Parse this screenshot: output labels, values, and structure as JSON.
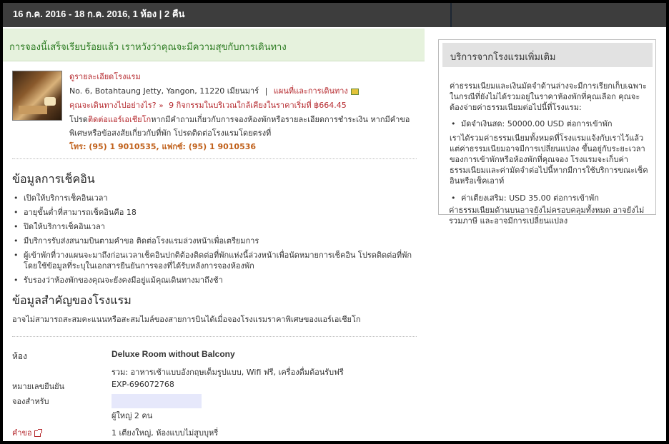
{
  "header": {
    "dates": "16 ก.ค. 2016 - 18 ก.ค. 2016, 1 ห้อง | 2 คืน"
  },
  "success": {
    "message": "การจองนี้เสร็จเรียบร้อยแล้ว เราหวังว่าคุณจะมีความสุขกับการเดินทาง"
  },
  "hotel": {
    "details_link": "ดูรายละเอียดโรงแรม",
    "address": "No. 6, Botahtaung Jetty, Yangon, 11220 เมียนมาร์",
    "divider": "|",
    "map_link": "แผนที่และการเดินทาง",
    "getting_there": "คุณจะเดินทางไปอย่างไร?",
    "activities": "9 กิจกรรมในบริเวณใกล้เคียงในราคาเริ่มที่ ฿664.45",
    "contact_note_1": "โปรด",
    "contact_note_link": "ติดต่อแอร์เอเชียโก",
    "contact_note_2": "หากมีคำถามเกี่ยวกับการจองห้องพักหรือรายละเอียดการชำระเงิน หากมีคำขอ",
    "contact_note_3": "พิเศษหรือข้อสงสัยเกี่ยวกับที่พัก โปรดติดต่อโรงแรมโดยตรงที่",
    "phone": "โทร: (95) 1 9010535, แฟกซ์: (95) 1 9010536"
  },
  "checkin": {
    "title": "ข้อมูลการเช็คอิน",
    "items": [
      "เปิดให้บริการเช็คอินเวลา",
      "อายุขั้นต่ำที่สามารถเช็คอินคือ 18",
      "ปิดให้บริการเช็คอินเวลา",
      "มีบริการรับส่งสนามบินตามคำขอ ติดต่อโรงแรมล่วงหน้าเพื่อเตรียมการ",
      "ผู้เข้าพักที่วางแผนจะมาถึงก่อนเวลาเช็คอินปกติต้องติดต่อที่พักแห่งนี้ล่วงหน้าเพื่อนัดหมายการเช็คอิน โปรดติดต่อที่พักโดยใช้ข้อมูลที่ระบุในเอกสารยืนยันการจองที่ได้รับหลังการจองห้องพัก",
      "รับรองว่าห้องพักของคุณจะยังคงมีอยู่แม้คุณเดินทางมาถึงช้า"
    ]
  },
  "important": {
    "title": "ข้อมูลสำคัญของโรงแรม",
    "text": "อาจไม่สามารถสะสมคะแนนหรือสะสมไมล์ของสายการบินได้เมื่อจองโรงแรมราคาพิเศษของแอร์เอเชียโก"
  },
  "room": {
    "room_label": "ห้อง",
    "room_name": "Deluxe Room without Balcony",
    "includes": "รวม: อาหารเช้าแบบอังกฤษเต็มรูปแบบ, Wifi ฟรี, เครื่องดื่มต้อนรับฟรี",
    "confirmation_label": "หมายเลขยืนยัน",
    "confirmation_value": "EXP-696072768",
    "booked_for_label": "จองสำหรับ",
    "guests": "ผู้ใหญ่ 2 คน",
    "request_label": "คำขอ",
    "request_value": "1 เตียงใหญ่, ห้องแบบไม่สูบบุหรี่"
  },
  "sidebar": {
    "title": "บริการจากโรงแรมเพิ่มเติม",
    "intro": "ค่าธรรมเนียมและเงินมัดจำด้านล่างจะมีการเรียกเก็บเฉพาะในกรณีที่ยังไม่ได้รวมอยู่ในราคาห้องพักที่คุณเลือก คุณจะต้องจ่ายค่าธรรมเนียมต่อไปนี้ที่โรงแรม:",
    "deposit": "มัดจำเงินสด: 50000.00 USD ต่อการเข้าพัก",
    "note": "เราได้รวมค่าธรรมเนียมทั้งหมดที่โรงแรมแจ้งกับเราไว้แล้ว แต่ค่าธรรมเนียมอาจมีการเปลี่ยนแปลง ขึ้นอยู่กับระยะเวลาของการเข้าพักหรือห้องพักที่คุณจอง โรงแรมจะเก็บค่าธรรมเนียมและค่ามัดจำต่อไปนี้หากมีการใช้บริการขณะเช็คอินหรือเช็คเอาท์",
    "extra_bed": "ค่าเตียงเสริม: USD 35.00 ต่อการเข้าพัก",
    "footer": "ค่าธรรมเนียมด้านบนอาจยังไม่ครอบคลุมทั้งหมด อาจยังไม่รวมภาษี และอาจมีการเปลี่ยนแปลง"
  },
  "colors": {
    "header_bg": "#3d3d3d",
    "success_bg": "#e6f2dd",
    "success_text": "#2a7a1f",
    "link_red": "#b5282d",
    "phone_orange": "#c0601a"
  }
}
